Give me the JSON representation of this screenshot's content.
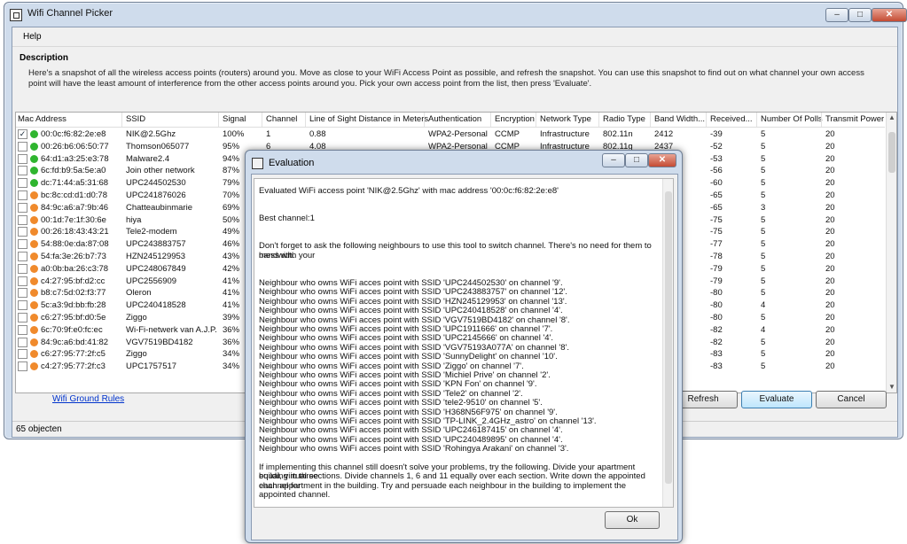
{
  "window": {
    "title": "Wifi Channel Picker",
    "btn_min": "–",
    "btn_max": "□",
    "btn_close": "✕"
  },
  "menu": {
    "help": "Help"
  },
  "description": {
    "heading": "Description",
    "text": "Here's a snapshot of all the wireless access points (routers) around you. Move as close to your WiFi Access Point as possible, and refresh the snapshot. You can use this snapshot to find out on what channel your own access point will have the least amount of interference from the other access points around you. Pick your own access point from the list, then press 'Evaluate'."
  },
  "table": {
    "columns": [
      "Mac Address",
      "SSID",
      "Signal",
      "Channel",
      "Line of Sight Distance in Meters",
      "Authentication",
      "Encryption",
      "Network Type",
      "Radio Type",
      "Band Width...",
      "Received...",
      "Number Of Polls",
      "Transmit Power"
    ],
    "rows": [
      {
        "checked": "✓",
        "color": "#2fb52f",
        "mac": "00:0c:f6:82:2e:e8",
        "ssid": "NIK@2.5Ghz",
        "signal": "100%",
        "channel": "1",
        "dist": "0.88",
        "auth": "WPA2-Personal",
        "enc": "CCMP",
        "net": "Infrastructure",
        "radio": "802.11n",
        "bw": "2412",
        "recv": "-39",
        "polls": "5",
        "tx": "20"
      },
      {
        "checked": "",
        "color": "#2fb52f",
        "mac": "00:26:b6:06:50:77",
        "ssid": "Thomson065077",
        "signal": "95%",
        "channel": "6",
        "dist": "4.08",
        "auth": "WPA2-Personal",
        "enc": "CCMP",
        "net": "Infrastructure",
        "radio": "802.11g",
        "bw": "2437",
        "recv": "-52",
        "polls": "5",
        "tx": "20"
      },
      {
        "checked": "",
        "color": "#2fb52f",
        "mac": "64:d1:a3:25:e3:78",
        "ssid": "Malware2.4",
        "signal": "94%",
        "channel": "",
        "dist": "",
        "auth": "",
        "enc": "",
        "net": "",
        "radio": "",
        "bw": "",
        "recv": "-53",
        "polls": "5",
        "tx": "20"
      },
      {
        "checked": "",
        "color": "#2fb52f",
        "mac": "6c:fd:b9:5a:5e:a0",
        "ssid": "Join other network",
        "signal": "87%",
        "channel": "",
        "dist": "",
        "auth": "",
        "enc": "",
        "net": "",
        "radio": "",
        "bw": "",
        "recv": "-56",
        "polls": "5",
        "tx": "20"
      },
      {
        "checked": "",
        "color": "#2fb52f",
        "mac": "dc:71:44:a5:31:68",
        "ssid": "UPC244502530",
        "signal": "79%",
        "channel": "",
        "dist": "",
        "auth": "",
        "enc": "",
        "net": "",
        "radio": "",
        "bw": "",
        "recv": "-60",
        "polls": "5",
        "tx": "20"
      },
      {
        "checked": "",
        "color": "#f08a2c",
        "mac": "bc:8c:cd:d1:d0:78",
        "ssid": "UPC241876026",
        "signal": "70%",
        "channel": "",
        "dist": "",
        "auth": "",
        "enc": "",
        "net": "",
        "radio": "",
        "bw": "",
        "recv": "-65",
        "polls": "5",
        "tx": "20"
      },
      {
        "checked": "",
        "color": "#f08a2c",
        "mac": "84:9c:a6:a7:9b:46",
        "ssid": "Chatteaubinmarie",
        "signal": "69%",
        "channel": "",
        "dist": "",
        "auth": "",
        "enc": "",
        "net": "",
        "radio": "",
        "bw": "",
        "recv": "-65",
        "polls": "3",
        "tx": "20"
      },
      {
        "checked": "",
        "color": "#f08a2c",
        "mac": "00:1d:7e:1f:30:6e",
        "ssid": "hiya",
        "signal": "50%",
        "channel": "",
        "dist": "",
        "auth": "",
        "enc": "",
        "net": "",
        "radio": "",
        "bw": "",
        "recv": "-75",
        "polls": "5",
        "tx": "20"
      },
      {
        "checked": "",
        "color": "#f08a2c",
        "mac": "00:26:18:43:43:21",
        "ssid": "Tele2-modem",
        "signal": "49%",
        "channel": "",
        "dist": "",
        "auth": "",
        "enc": "",
        "net": "",
        "radio": "",
        "bw": "",
        "recv": "-75",
        "polls": "5",
        "tx": "20"
      },
      {
        "checked": "",
        "color": "#f08a2c",
        "mac": "54:88:0e:da:87:08",
        "ssid": "UPC243883757",
        "signal": "46%",
        "channel": "",
        "dist": "",
        "auth": "",
        "enc": "",
        "net": "",
        "radio": "",
        "bw": "",
        "recv": "-77",
        "polls": "5",
        "tx": "20"
      },
      {
        "checked": "",
        "color": "#f08a2c",
        "mac": "54:fa:3e:26:b7:73",
        "ssid": "HZN245129953",
        "signal": "43%",
        "channel": "",
        "dist": "",
        "auth": "",
        "enc": "",
        "net": "",
        "radio": "",
        "bw": "",
        "recv": "-78",
        "polls": "5",
        "tx": "20"
      },
      {
        "checked": "",
        "color": "#f08a2c",
        "mac": "a0:0b:ba:26:c3:78",
        "ssid": "UPC248067849",
        "signal": "42%",
        "channel": "",
        "dist": "",
        "auth": "",
        "enc": "",
        "net": "",
        "radio": "",
        "bw": "",
        "recv": "-79",
        "polls": "5",
        "tx": "20"
      },
      {
        "checked": "",
        "color": "#f08a2c",
        "mac": "c4:27:95:bf:d2:cc",
        "ssid": "UPC2556909",
        "signal": "41%",
        "channel": "",
        "dist": "",
        "auth": "",
        "enc": "",
        "net": "",
        "radio": "",
        "bw": "",
        "recv": "-79",
        "polls": "5",
        "tx": "20"
      },
      {
        "checked": "",
        "color": "#f08a2c",
        "mac": "b8:c7:5d:02:f3:77",
        "ssid": "Oleron",
        "signal": "41%",
        "channel": "",
        "dist": "",
        "auth": "",
        "enc": "",
        "net": "",
        "radio": "",
        "bw": "",
        "recv": "-80",
        "polls": "5",
        "tx": "20"
      },
      {
        "checked": "",
        "color": "#f08a2c",
        "mac": "5c:a3:9d:bb:fb:28",
        "ssid": "UPC240418528",
        "signal": "41%",
        "channel": "",
        "dist": "",
        "auth": "",
        "enc": "",
        "net": "",
        "radio": "",
        "bw": "",
        "recv": "-80",
        "polls": "4",
        "tx": "20"
      },
      {
        "checked": "",
        "color": "#f08a2c",
        "mac": "c6:27:95:bf:d0:5e",
        "ssid": "Ziggo",
        "signal": "39%",
        "channel": "",
        "dist": "",
        "auth": "",
        "enc": "",
        "net": "",
        "radio": "",
        "bw": "",
        "recv": "-80",
        "polls": "5",
        "tx": "20"
      },
      {
        "checked": "",
        "color": "#f08a2c",
        "mac": "6c:70:9f:e0:fc:ec",
        "ssid": "Wi-Fi-netwerk van A.J.P.",
        "signal": "36%",
        "channel": "",
        "dist": "",
        "auth": "",
        "enc": "",
        "net": "",
        "radio": "",
        "bw": "",
        "recv": "-82",
        "polls": "4",
        "tx": "20"
      },
      {
        "checked": "",
        "color": "#f08a2c",
        "mac": "84:9c:a6:bd:41:82",
        "ssid": "VGV7519BD4182",
        "signal": "36%",
        "channel": "",
        "dist": "",
        "auth": "",
        "enc": "",
        "net": "",
        "radio": "",
        "bw": "",
        "recv": "-82",
        "polls": "5",
        "tx": "20"
      },
      {
        "checked": "",
        "color": "#f08a2c",
        "mac": "c6:27:95:77:2f:c5",
        "ssid": "Ziggo",
        "signal": "34%",
        "channel": "",
        "dist": "",
        "auth": "",
        "enc": "",
        "net": "",
        "radio": "",
        "bw": "",
        "recv": "-83",
        "polls": "5",
        "tx": "20"
      },
      {
        "checked": "",
        "color": "#f08a2c",
        "mac": "c4:27:95:77:2f:c3",
        "ssid": "UPC1757517",
        "signal": "34%",
        "channel": "",
        "dist": "",
        "auth": "",
        "enc": "",
        "net": "",
        "radio": "",
        "bw": "",
        "recv": "-83",
        "polls": "5",
        "tx": "20"
      }
    ]
  },
  "footer": {
    "link": "Wifi Ground Rules",
    "refresh": "Refresh",
    "evaluate": "Evaluate",
    "cancel": "Cancel",
    "status": "65 objecten"
  },
  "dialog": {
    "title": "Evaluation",
    "ok": "Ok",
    "lines": [
      "Evaluated WiFi access point 'NIK@2.5Ghz' with mac address '00:0c:f6:82:2e:e8'",
      "",
      "",
      "Best channel:1",
      "",
      "",
      "Don't forget to ask the following neighbours to use this tool to switch channel. There's no need for them to mess with your",
      "bandwith.",
      "",
      "",
      "Neighbour who owns WiFi acces point with SSID 'UPC244502530' on channel '9'.",
      "Neighbour who owns WiFi acces point with SSID 'UPC243883757' on channel '12'.",
      "Neighbour who owns WiFi acces point with SSID 'HZN245129953' on channel '13'.",
      "Neighbour who owns WiFi acces point with SSID 'UPC240418528' on channel '4'.",
      "Neighbour who owns WiFi acces point with SSID 'VGV7519BD4182' on channel '8'.",
      "Neighbour who owns WiFi acces point with SSID 'UPC1911666' on channel '7'.",
      "Neighbour who owns WiFi acces point with SSID 'UPC2145666' on channel '4'.",
      "Neighbour who owns WiFi acces point with SSID 'VGV75193A077A' on channel '8'.",
      "Neighbour who owns WiFi acces point with SSID 'SunnyDelight' on channel '10'.",
      "Neighbour who owns WiFi acces point with SSID 'Ziggo' on channel '7'.",
      "Neighbour who owns WiFi acces point with SSID 'Michiel Prive' on channel '2'.",
      "Neighbour who owns WiFi acces point with SSID 'KPN Fon' on channel '9'.",
      "Neighbour who owns WiFi acces point with SSID 'Tele2' on channel '2'.",
      "Neighbour who owns WiFi acces point with SSID 'tele2-9510' on channel '5'.",
      "Neighbour who owns WiFi acces point with SSID 'H368N56F975' on channel '9'.",
      "Neighbour who owns WiFi acces point with SSID 'TP-LINK_2.4GHz_astro' on channel '13'.",
      "Neighbour who owns WiFi acces point with SSID 'UPC246187415' on channel '4'.",
      "Neighbour who owns WiFi acces point with SSID 'UPC240489895' on channel '4'.",
      "Neighbour who owns WiFi acces point with SSID 'Rohingya Arakani' on channel '3'.",
      "",
      "If implementing this channel still doesn't solve your problems, try the following. Divide your apartment building in three",
      "equal, virtual sections. Divide channels 1, 6 and 11 equally over each section. Write down the appointed channel for",
      "each appartment in the building. Try and persuade each neighbour in the building to implement the appointed channel."
    ]
  }
}
